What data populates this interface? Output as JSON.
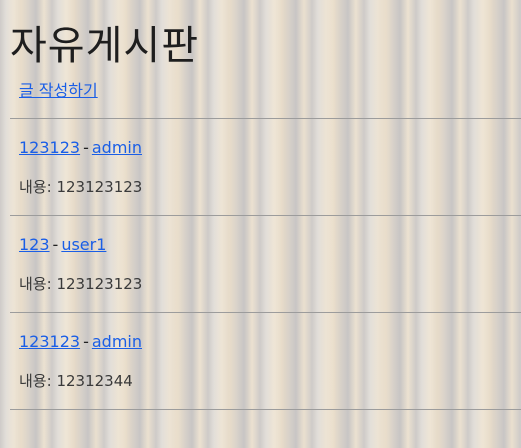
{
  "header": {
    "title": "자유게시판",
    "write_link": "글 작성하기"
  },
  "posts": [
    {
      "title": "123123",
      "separator": "-",
      "author": "admin",
      "content_prefix": "내용:",
      "content": "123123123"
    },
    {
      "title": "123",
      "separator": "-",
      "author": "user1",
      "content_prefix": "내용:",
      "content": "123123123"
    },
    {
      "title": "123123",
      "separator": "-",
      "author": "admin",
      "content_prefix": "내용:",
      "content": "12312344"
    }
  ],
  "colors": {
    "link": "#1a5ee6",
    "divider": "#9c9c9c",
    "text": "#222222"
  }
}
